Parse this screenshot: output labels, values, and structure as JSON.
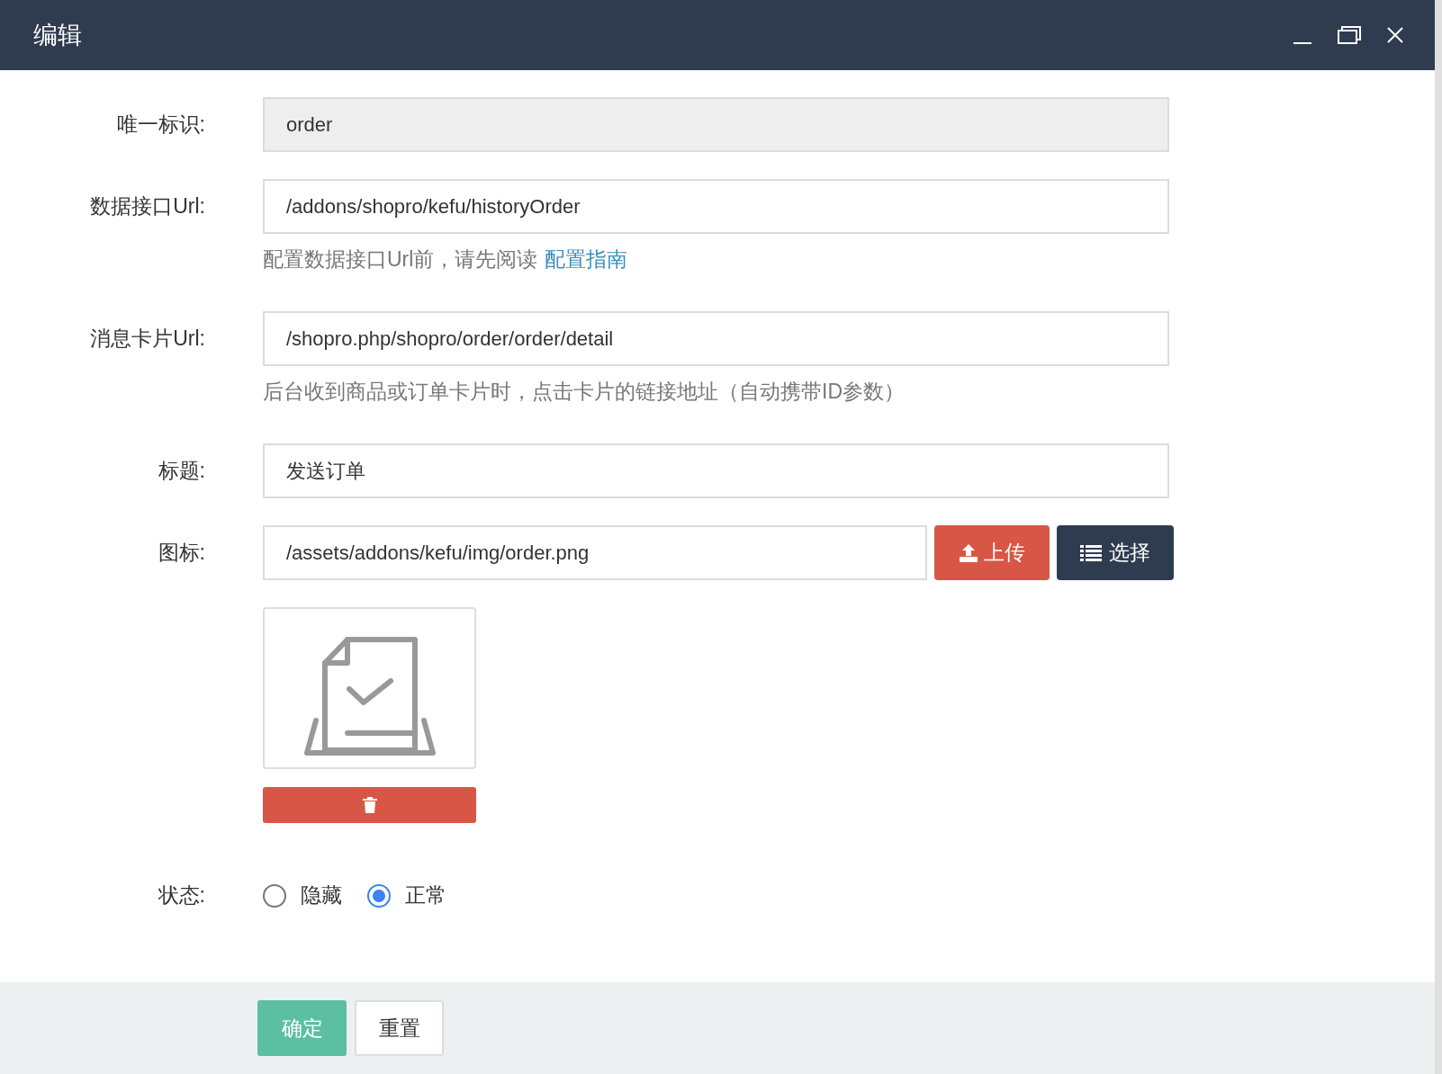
{
  "window": {
    "title": "编辑"
  },
  "fields": [
    {
      "kind": "text",
      "label": "唯一标识:",
      "value": "order",
      "disabled": true
    },
    {
      "kind": "text",
      "label": "数据接口Url:",
      "value": "/addons/shopro/kefu/historyOrder",
      "disabled": false,
      "hint": "配置数据接口Url前，请先阅读",
      "hint_link": "配置指南"
    },
    {
      "kind": "text",
      "label": "消息卡片Url:",
      "value": "/shopro.php/shopro/order/order/detail",
      "disabled": false,
      "hint": "后台收到商品或订单卡片时，点击卡片的链接地址（自动携带ID参数）"
    },
    {
      "kind": "text",
      "label": "标题:",
      "value": "发送订单",
      "disabled": false
    },
    {
      "kind": "image",
      "label": "图标:",
      "value": "/assets/addons/kefu/img/order.png",
      "upload_button": "上传",
      "select_button": "选择"
    },
    {
      "kind": "radio",
      "label": "状态:",
      "options": [
        {
          "label": "隐藏",
          "selected": false
        },
        {
          "label": "正常",
          "selected": true
        }
      ]
    }
  ],
  "footer": {
    "buttons": [
      {
        "label": "确定",
        "kind": "primary"
      },
      {
        "label": "重置",
        "kind": "default"
      }
    ]
  }
}
